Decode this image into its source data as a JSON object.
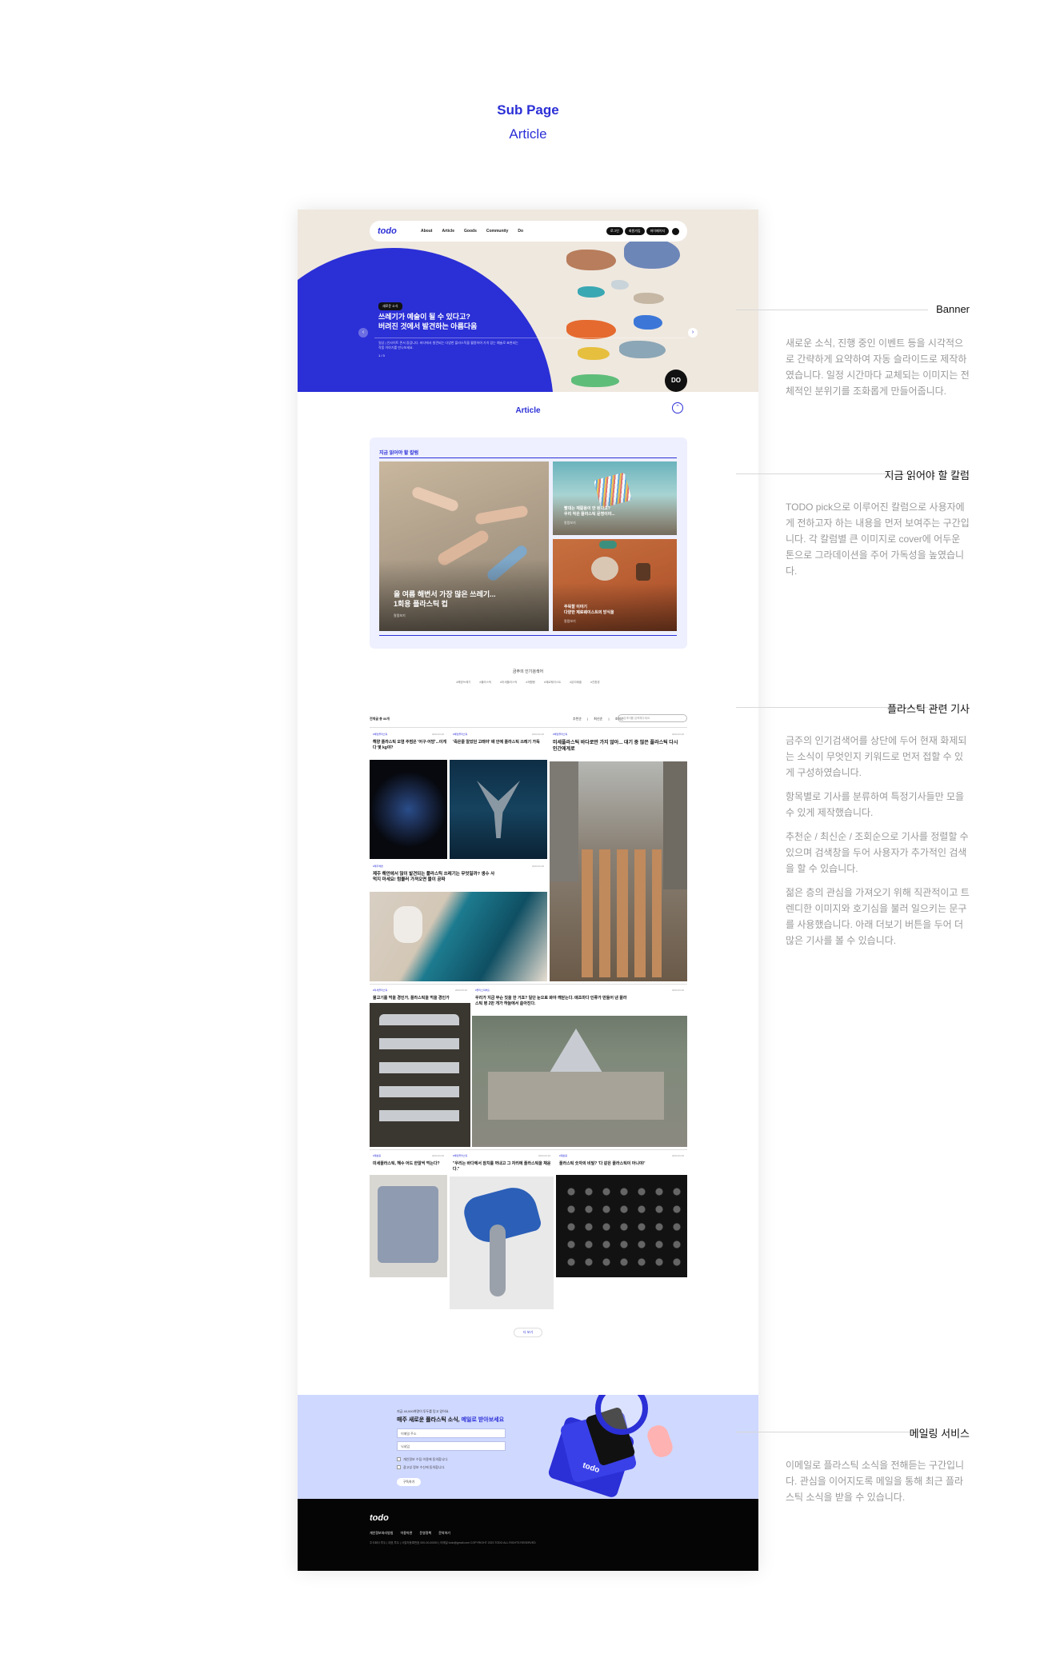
{
  "page": {
    "heading": "Sub Page",
    "subheading": "Article"
  },
  "nav": {
    "logo": "todo",
    "menu": [
      "About",
      "Article",
      "Goods",
      "Community",
      "Do"
    ],
    "buttons": [
      "로그인",
      "회원가입",
      "마이페이지"
    ]
  },
  "banner": {
    "tag": "새로운 소식",
    "title_line1": "쓰레기가 예술이 될 수 있다고?",
    "title_line2": "버려진 것에서 발견하는 아름다움",
    "desc": "일상 | 인사이트 존서 광감니다. 바다에서 발견되는 다양한 플라스틱을 활용하여 가치 있는 예술로 표현되는 작품 이야기를 만나보세요.",
    "counter": "1 / 3",
    "do_button": "DO"
  },
  "article": {
    "title": "Article"
  },
  "pick": {
    "heading": "지금 읽어야 할 칼럼",
    "big_title_line1": "올 여름 해변서 가장 많은 쓰레기...",
    "big_title_line2": "1회용 플라스틱 컵",
    "big_sub": "칼럼보기",
    "s1_title_line1": "빨대는 재활용이 안 된다고?",
    "s1_title_line2": "우리 작은 플라스틱 문명이야...",
    "s1_sub": "칼럼보기",
    "s2_title_line1": "주목할 이야기",
    "s2_title_line2": "다양한 제로웨이스트의 방식을",
    "s2_sub": "칼럼보기"
  },
  "popular": {
    "title": "금주의 인기검색어",
    "keywords": "#해양쓰레기 #플라스틱 #미세플라스틱 #재활용 #제로웨이스트 #분리배출 #친환경"
  },
  "toolbar": {
    "label": "전체글 총 88개",
    "sorts": "추천순 | 최신순 | 조회순",
    "search_placeholder": "검색어를 입력해주세요"
  },
  "articles": [
    {
      "cat": "#해양플라스틱",
      "date": "2023.03.26",
      "title": "해양 플라스틱 오염 주범은 '어구·어망'...이게 다 몇 kg야?"
    },
    {
      "cat": "#해양플라스틱",
      "date": "2023.03.26",
      "title": "'죽은줄 알았던 고래야' 배 안에 플라스틱 쓰레기 가득"
    },
    {
      "cat": "#해양플라스틱",
      "date": "2023.03.26",
      "title": "미세플라스틱 바다로만 가지 않아... 대기 중 많은 플라스틱 다시 인간에게로"
    },
    {
      "cat": "#제주해변",
      "date": "2023.03.26",
      "title": "제주 해안에서 많이 발견되는 플라스틱 쓰레기는 무엇일까? 생수 사먹지 마세요! 텀블러 가져오면 물이 공짜"
    },
    {
      "cat": "#미세플라스틱",
      "date": "2023.03.26",
      "title": "물고기를 먹을 경인가, 플라스틱을 먹을 경인가"
    },
    {
      "cat": "#플라스틱배출",
      "date": "2023.03.26",
      "title": "우리가 지금 무슨 짓을 한 거죠? 일단 눈으로 봐야 깨닫는다. 매초마다 인류가 만들어 낸 플라스틱 병 2만 개가 하늘에서 쏟아진다."
    },
    {
      "cat": "#재활용",
      "date": "2023.03.26",
      "title": "미세플라스틱, 해수 어드 한알씩 먹는다?"
    },
    {
      "cat": "#해양플라스틱",
      "date": "2023.03.26",
      "title": "\"우리는 바다에서 참치를 꺼내고 그 자리에 플라스틱을 채운다.\""
    },
    {
      "cat": "#재활용",
      "date": "2023.03.26",
      "title": "플라스틱 숫자의 비밀? '다 같은 플라스틱이 아니야!'"
    }
  ],
  "more_button": "더 보기",
  "newsletter": {
    "small": "지금 40,000여명이 투두를 믿고 있어요.",
    "title_plain": "매주 새로운 플라스틱 소식, ",
    "title_highlight": "메일로 받아보세요",
    "email_placeholder": "이메일 주소",
    "name_placeholder": "닉네임",
    "check1": "개인정보 수집·이용에 동의합니다.",
    "check2": "광고성 정보 수신에 동의합니다.",
    "submit": "구독하기",
    "card_logo": "todo"
  },
  "footer": {
    "logo": "todo",
    "menu": "개인정보처리방침 이용약관 운영정책 문의하기",
    "info": "주식회사 투두 | 대표 투두 | 사업자등록번호 000-00-00000 | 이메일 todo@gmail.com COPYRIGHT 2023 TODO ALL RIGHTS RESERVED"
  },
  "annotations": [
    {
      "title": "Banner",
      "desc": [
        "새로운 소식, 진행 중인 이벤트 등을 시각적으로 간략하게 요약하여 자동 슬라이드로 제작하였습니다. 일정 시간마다 교체되는 이미지는 전체적인 분위기를 조화롭게 만들어줍니다."
      ]
    },
    {
      "title": "지금 읽어야 할 칼럼",
      "desc": [
        "TODO pick으로 이루어진 칼럼으로 사용자에게 전하고자 하는 내용을 먼저 보여주는 구간입니다. 각 칼럼별 큰 이미지로 cover에 어두운 톤으로 그라데이션을 주어 가독성을 높였습니다."
      ]
    },
    {
      "title": "플라스틱 관련 기사",
      "desc": [
        "금주의 인기검색어를 상단에 두어 현재 화제되는 소식이 무엇인지 키워드로 먼저 접할 수 있게 구성하였습니다.",
        "항목별로 기사를 분류하여 특정기사들만 모을 수 있게 제작했습니다.",
        "추천순 / 최신순 / 조회순으로 기사를 정렬할 수 있으며 검색창을 두어 사용자가 추가적인 검색을 할 수 있습니다.",
        "젊은 층의 관심을 가져오기 위해 직관적이고 트렌디한 이미지와 호기심을 불러 일으키는 문구를 사용했습니다. 아래 더보기 버튼을 두어 더 많은 기사를 볼 수 있습니다."
      ]
    },
    {
      "title": "메일링 서비스",
      "desc": [
        "이메일로 플라스틱 소식을 전해듣는 구간입니다. 관심을 이어지도록 메일을 통해 최근 플라스틱 소식을 받을 수 있습니다."
      ]
    }
  ],
  "colors": {
    "accent": "#2b2fd6",
    "banner_bg": "#efe8df",
    "news_bg": "#cfd8ff",
    "pick_bg": "#eef0ff"
  }
}
